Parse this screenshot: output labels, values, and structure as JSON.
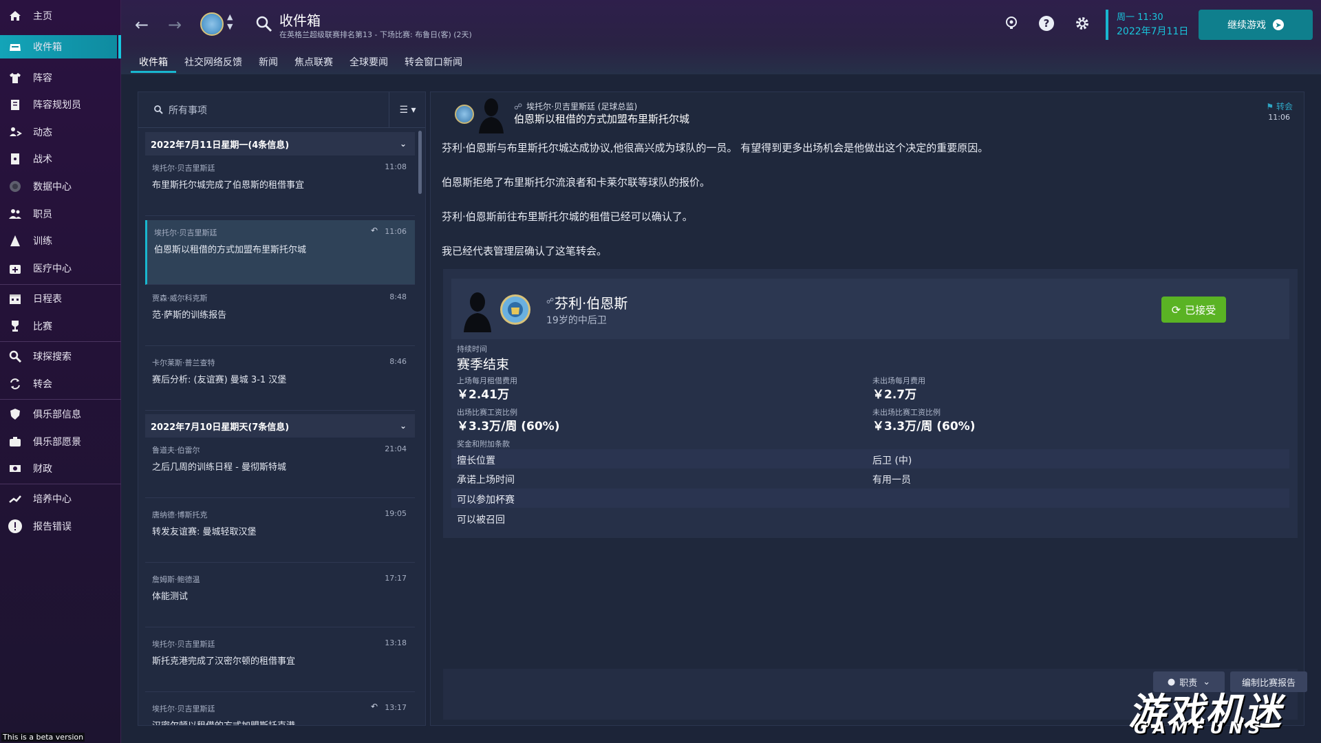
{
  "sidebar": {
    "items": [
      {
        "label": "主页",
        "icon": "home-icon"
      },
      {
        "label": "收件箱",
        "icon": "inbox-icon"
      },
      {
        "label": "阵容",
        "icon": "shirt-icon"
      },
      {
        "label": "阵容规划员",
        "icon": "clipboard-icon"
      },
      {
        "label": "动态",
        "icon": "dynamics-icon"
      },
      {
        "label": "战术",
        "icon": "tactics-icon"
      },
      {
        "label": "数据中心",
        "icon": "data-center-icon"
      },
      {
        "label": "职员",
        "icon": "staff-icon"
      },
      {
        "label": "训练",
        "icon": "training-icon"
      },
      {
        "label": "医疗中心",
        "icon": "medical-icon"
      },
      {
        "label": "日程表",
        "icon": "calendar-icon"
      },
      {
        "label": "比赛",
        "icon": "trophy-icon"
      },
      {
        "label": "球探搜索",
        "icon": "search-icon"
      },
      {
        "label": "转会",
        "icon": "transfer-icon"
      },
      {
        "label": "俱乐部信息",
        "icon": "shield-icon"
      },
      {
        "label": "俱乐部愿景",
        "icon": "vision-icon"
      },
      {
        "label": "财政",
        "icon": "finance-icon"
      },
      {
        "label": "培养中心",
        "icon": "development-icon"
      },
      {
        "label": "报告错误",
        "icon": "report-icon"
      }
    ],
    "beta_text": "This is a beta version"
  },
  "header": {
    "title": "收件箱",
    "subtitle": "在英格兰超级联赛排名第13 - 下场比赛: 布鲁日(客) (2天)",
    "tabs": [
      "收件箱",
      "社交网络反馈",
      "新闻",
      "焦点联赛",
      "全球要闻",
      "转会窗口新闻"
    ],
    "date_line1": "周一 11:30",
    "date_line2": "2022年7月11日",
    "continue_label": "继续游戏"
  },
  "list": {
    "search_placeholder": "所有事项",
    "groups": [
      {
        "heading": "2022年7月11日星期一(4条信息)",
        "messages": [
          {
            "from": "埃托尔·贝吉里斯廷",
            "time": "11:08",
            "subject": "布里斯托尔城完成了伯恩斯的租借事宜"
          },
          {
            "from": "埃托尔·贝吉里斯廷",
            "time": "11:06",
            "subject": "伯恩斯以租借的方式加盟布里斯托尔城"
          },
          {
            "from": "贾森·威尔科克斯",
            "time": "8:48",
            "subject": "范·萨斯的训练报告"
          },
          {
            "from": "卡尔莱斯·普兰查特",
            "time": "8:46",
            "subject": "赛后分析: (友谊赛) 曼城 3-1 汉堡"
          }
        ]
      },
      {
        "heading": "2022年7月10日星期天(7条信息)",
        "messages": [
          {
            "from": "鲁道夫·伯雷尔",
            "time": "21:04",
            "subject": "之后几周的训练日程 - 曼彻斯特城"
          },
          {
            "from": "唐纳德·博斯托克",
            "time": "19:05",
            "subject": "转发友谊赛: 曼城轻取汉堡"
          },
          {
            "from": "詹姆斯·鲍德温",
            "time": "17:17",
            "subject": "体能测试"
          },
          {
            "from": "埃托尔·贝吉里斯廷",
            "time": "13:18",
            "subject": "斯托克港完成了汉密尔顿的租借事宜"
          },
          {
            "from": "埃托尔·贝吉里斯廷",
            "time": "13:17",
            "subject": "汉密尔顿以租借的方式加盟斯托克港"
          }
        ]
      }
    ]
  },
  "detail": {
    "sender": "埃托尔·贝吉里斯廷 (足球总监)",
    "subject": "伯恩斯以租借的方式加盟布里斯托尔城",
    "tag": "转会",
    "time": "11:06",
    "paragraphs": [
      "芬利·伯恩斯与布里斯托尔城达成协议,他很高兴成为球队的一员。 有望得到更多出场机会是他做出这个决定的重要原因。",
      "伯恩斯拒绝了布里斯托尔流浪者和卡莱尔联等球队的报价。",
      "芬利·伯恩斯前往布里斯托尔城的租借已经可以确认了。",
      "我已经代表管理层确认了这笔转会。"
    ],
    "player": {
      "name": "芬利·伯恩斯",
      "sub": "19岁的中后卫",
      "accepted_label": "已接受"
    },
    "terms": {
      "duration_label": "持续时间",
      "duration_value": "赛季结束",
      "monthly_fee_label": "上场每月租借费用",
      "monthly_fee_value": "￥2.41万",
      "unused_fee_label": "未出场每月费用",
      "unused_fee_value": "￥2.7万",
      "wage_label": "出场比赛工资比例",
      "wage_value": "￥3.3万/周 (60%)",
      "unused_wage_label": "未出场比赛工资比例",
      "unused_wage_value": "￥3.3万/周 (60%)",
      "bonus_label": "奖金和附加条款"
    },
    "rows": [
      {
        "k": "擅长位置",
        "v": "后卫 (中)"
      },
      {
        "k": "承诺上场时间",
        "v": "有用一员"
      },
      {
        "k": "可以参加杯赛",
        "v": ""
      },
      {
        "k": "可以被召回",
        "v": ""
      }
    ],
    "bottom": {
      "staff_label": "职责",
      "report_label": "编制比赛报告"
    }
  },
  "watermark": {
    "main": "游戏机迷",
    "sub": "GAMFUNS"
  },
  "colors": {
    "accent": "#19b7cf",
    "accepted": "#5ab324",
    "sidebar": "#2a1240"
  }
}
